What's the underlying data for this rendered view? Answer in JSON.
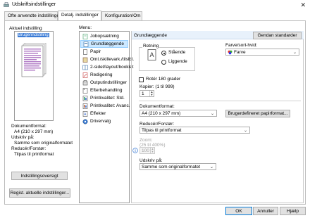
{
  "window": {
    "title": "Udskriftsindstillinger"
  },
  "tabs": [
    {
      "label": "Ofte anvendte indstillinger"
    },
    {
      "label": "Detalj. indstillinger"
    },
    {
      "label": "Konfiguration/Om"
    }
  ],
  "left": {
    "current_setting_label": "Aktuel indstilling",
    "current_setting_value": "Brugerindstilling",
    "summary": [
      "Dokumentformat:",
      "  A4 (210 x 297 mm)",
      "Udskriv på:",
      "  Samme som originalformatet",
      "Reducér/Forstør:",
      "  Tilpas til printformat"
    ],
    "overview_button": "Indstillingsoversigt",
    "register_button": "Regist. aktuelle indstillinger..."
  },
  "menu": {
    "label": "Menu:",
    "items": [
      {
        "label": "Jobopsætning",
        "icon": "job-setup-icon"
      },
      {
        "label": "Grundlæggende",
        "icon": "basic-icon",
        "selected": true
      },
      {
        "label": "Papir",
        "icon": "paper-icon"
      },
      {
        "label": "Oml./skillevark./tilslbl.",
        "icon": "cover-icon"
      },
      {
        "label": "2-sidet/layout/booklet",
        "icon": "duplex-icon"
      },
      {
        "label": "Redigering",
        "icon": "edit-icon"
      },
      {
        "label": "Outputindstillinger",
        "icon": "output-icon"
      },
      {
        "label": "Efterbehandling",
        "icon": "finishing-icon"
      },
      {
        "label": "Printkvalitet: Std.",
        "icon": "quality-std-icon"
      },
      {
        "label": "Printkvalitet: Avanc.",
        "icon": "quality-adv-icon"
      },
      {
        "label": "Effekter",
        "icon": "effects-icon"
      },
      {
        "label": "Drivervalg",
        "icon": "driver-icon"
      }
    ]
  },
  "content": {
    "header": "Grundlæggende",
    "reset_button": "Gendan standarder",
    "orientation_label": "Retning",
    "portrait_label": "Stående",
    "landscape_label": "Liggende",
    "color_label": "Farve/sort-hvid:",
    "color_value": "Farve",
    "rotate_label": "Rotér 180 grader",
    "copies_label": "Kopier: (1 til 999)",
    "copies_value": "1",
    "docsize_label": "Dokumentformat:",
    "docsize_value": "A4 (210 x 297 mm)",
    "custom_paper_button": "Brugerdefineret papirformat...",
    "reduce_label": "Reducér/Forstør:",
    "reduce_value": "Tilpas til printformat",
    "zoom_label": "Zoom:",
    "zoom_range": "(25 til 400%)",
    "zoom_value": "100",
    "printon_label": "Udskriv på:",
    "printon_value": "Samme som originalformatet"
  },
  "footer": {
    "ok": "OK",
    "cancel": "Annuller",
    "help": "Hjælp"
  },
  "colors": {
    "accent": "#0078d7",
    "selection": "#cce8ff",
    "header_bar": "#e8f1fb"
  }
}
